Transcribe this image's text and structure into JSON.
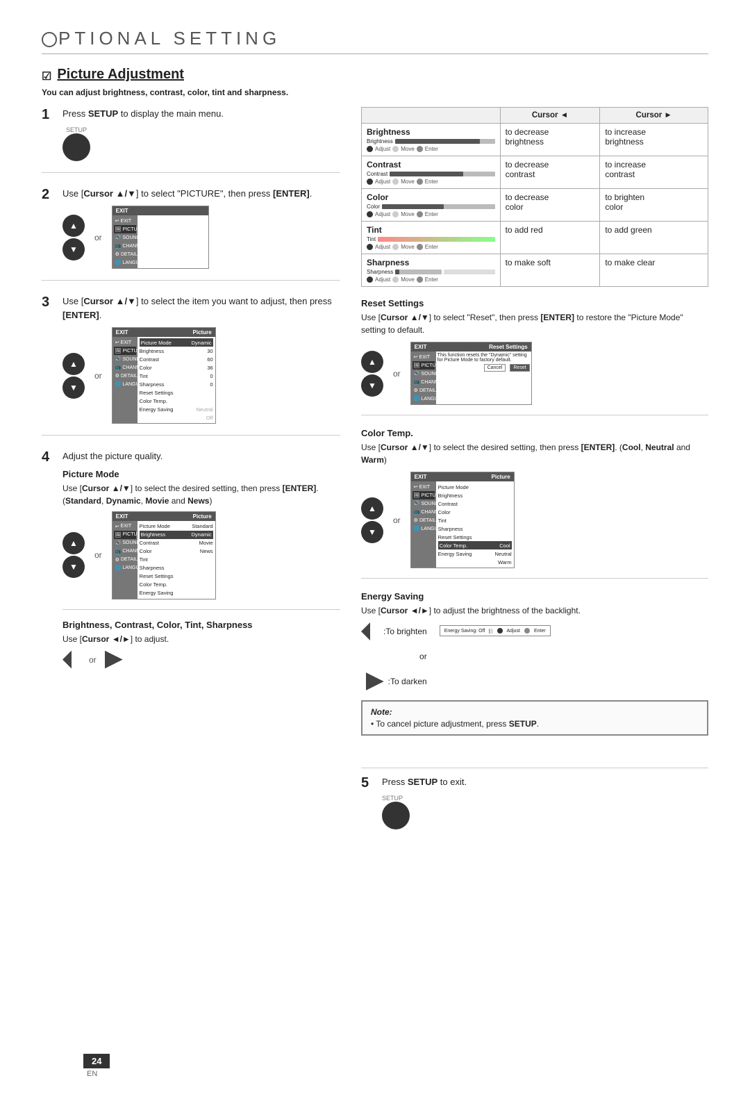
{
  "page": {
    "title_prefix": "PTIONAL  SETTING",
    "title_o": "O",
    "section_title": "Picture Adjustment",
    "section_subtitle": "You can adjust brightness, contrast, color, tint and sharpness.",
    "page_number": "24",
    "page_lang": "EN"
  },
  "steps": {
    "step1": {
      "num": "1",
      "text": "Press ",
      "bold": "SETUP",
      "text2": " to display the main menu.",
      "icon_label": "SETUP"
    },
    "step2": {
      "num": "2",
      "text": "Use [Cursor ▲/▼] to select \"PICTURE\", then press [ENTER].",
      "or": "or"
    },
    "step3": {
      "num": "3",
      "text": "Use [Cursor ▲/▼] to select the item you want to adjust, then press [ENTER].",
      "or": "or"
    },
    "step4": {
      "num": "4",
      "text": "Adjust the picture quality.",
      "or": "or"
    },
    "step5": {
      "num": "5",
      "text": "Press ",
      "bold": "SETUP",
      "text2": " to exit.",
      "icon_label": "SETUP"
    }
  },
  "subsections": {
    "picture_mode": {
      "title": "Picture Mode",
      "text1": "Use [Cursor ▲/▼] to select the desired setting, then press [ENTER]. (Standard, Dynamic, Movie and News)",
      "or": "or"
    },
    "brightness_contrast": {
      "title": "Brightness, Contrast, Color, Tint, Sharpness",
      "text": "Use [Cursor ◄/►] to adjust.",
      "or": "or"
    }
  },
  "table": {
    "col_cursor_left": "Cursor ◄",
    "col_cursor_right": "Cursor ►",
    "rows": [
      {
        "label": "Brightness",
        "bar_pct": 85,
        "left_action": "to decrease brightness",
        "right_action": "to increase brightness"
      },
      {
        "label": "Contrast",
        "bar_pct": 70,
        "left_action": "to decrease contrast",
        "right_action": "to increase contrast"
      },
      {
        "label": "Color",
        "bar_pct": 55,
        "left_action": "to decrease color",
        "right_action": "to brighten color"
      },
      {
        "label": "Tint",
        "bar_pct": 50,
        "left_action": "to add red",
        "right_action": "to add green",
        "tint": true
      },
      {
        "label": "Sharpness",
        "bar_pct": 10,
        "left_action": "to make soft",
        "right_action": "to make clear",
        "sharpness": true
      }
    ]
  },
  "right_sections": {
    "reset": {
      "title": "Reset Settings",
      "text": "Use [Cursor ▲/▼] to select \"Reset\", then press [ENTER] to restore the \"Picture Mode\" setting to default.",
      "or": "or"
    },
    "color_temp": {
      "title": "Color Temp.",
      "text": "Use [Cursor ▲/▼] to select the desired setting, then press [ENTER]. (Cool, Neutral and Warm)",
      "or": "or"
    },
    "energy_saving": {
      "title": "Energy Saving",
      "text": "Use [Cursor ◄/►] to adjust the brightness of the backlight.",
      "brighten_label": ":To brighten",
      "darken_label": ":To darken",
      "or": "or"
    }
  },
  "note": {
    "title": "Note:",
    "text": "• To cancel picture adjustment, press SETUP."
  },
  "menu_items": {
    "picture_sidebar": [
      "EXIT",
      "PICTURE",
      "SOUND",
      "CHANNEL",
      "DETAIL",
      "LANGUAGE"
    ],
    "picture_right": [
      "Picture Mode",
      "Brightness",
      "Contrast",
      "Color",
      "Tint",
      "Sharpness",
      "Reset Settings",
      "Color Temp.",
      "Energy Saving"
    ],
    "picture_right_vals": [
      "Standard",
      "Dynamic",
      "",
      "",
      "",
      "",
      "",
      "",
      "Movie",
      "News"
    ]
  }
}
